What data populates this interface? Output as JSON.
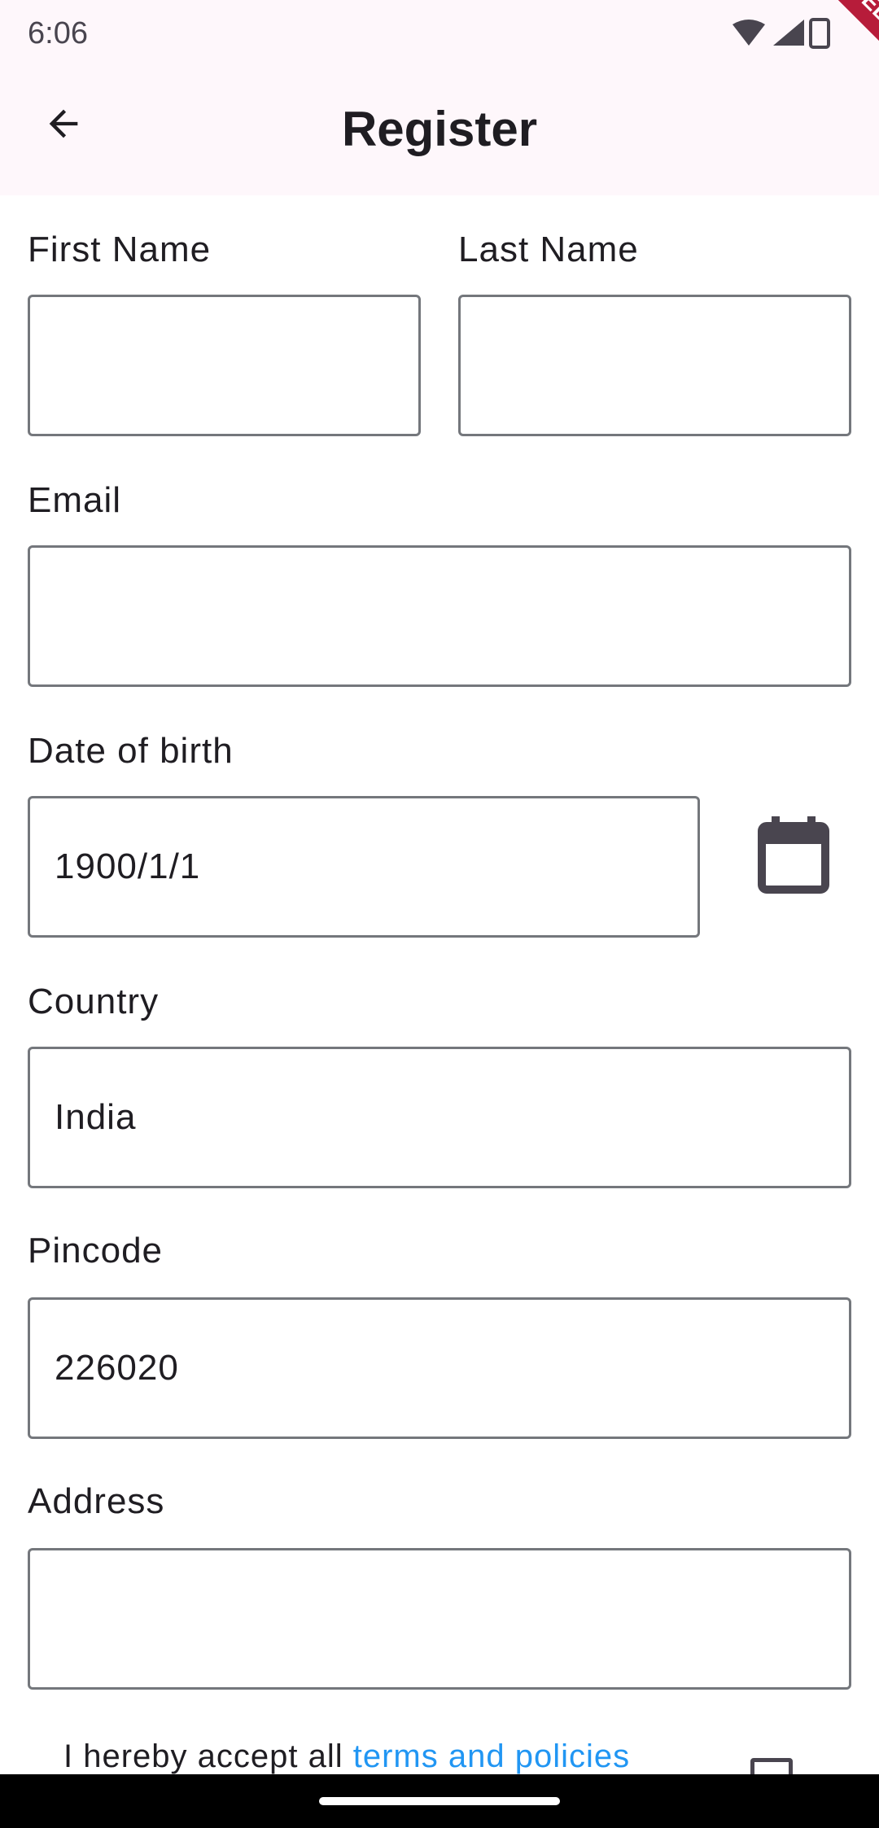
{
  "status_bar": {
    "time": "6:06",
    "icons": [
      "wifi-icon",
      "signal-icon",
      "battery-icon"
    ]
  },
  "app_bar": {
    "title": "Register",
    "back_icon": "arrow-left-icon",
    "debug_banner": "DEBUG"
  },
  "form": {
    "first_name": {
      "label": "First Name",
      "value": ""
    },
    "last_name": {
      "label": "Last Name",
      "value": ""
    },
    "email": {
      "label": "Email",
      "value": ""
    },
    "dob": {
      "label": "Date of birth",
      "value": "1900/1/1",
      "picker_icon": "calendar-icon"
    },
    "country": {
      "label": "Country",
      "value": "India"
    },
    "pincode": {
      "label": "Pincode",
      "value": "226020"
    },
    "address": {
      "label": "Address",
      "value": ""
    },
    "terms": {
      "prefix": "I hereby accept all ",
      "link": "terms and policies",
      "checked": false
    }
  },
  "colors": {
    "app_bar_bg": "#fef7fb",
    "link": "#2196f3",
    "field_border": "#74777c",
    "debug_banner": "#b71c3a"
  }
}
